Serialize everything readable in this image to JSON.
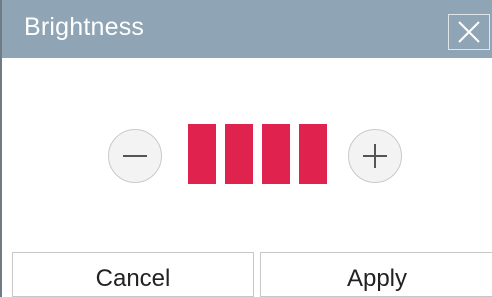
{
  "dialog": {
    "title": "Brightness",
    "close_icon": "close-icon"
  },
  "brightness": {
    "decrease_icon": "minus-icon",
    "increase_icon": "plus-icon",
    "level": 4,
    "max_level": 4,
    "bar_color": "#e0224f"
  },
  "footer": {
    "cancel_label": "Cancel",
    "apply_label": "Apply"
  }
}
